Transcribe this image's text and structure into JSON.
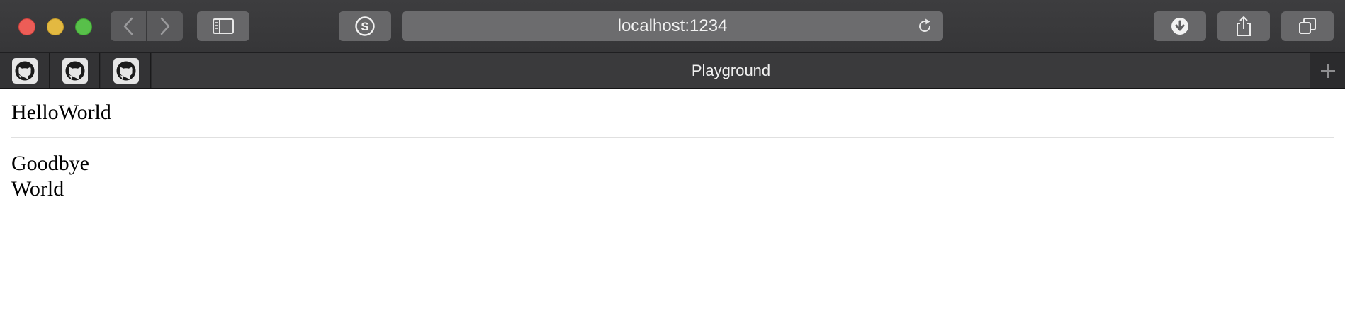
{
  "browser": {
    "address_bar": {
      "url": "localhost:1234"
    },
    "tabs": {
      "pinned": [
        {
          "icon": "github-icon"
        },
        {
          "icon": "github-icon"
        },
        {
          "icon": "github-icon"
        }
      ],
      "active_title": "Playground"
    },
    "colors": {
      "close": "#ed5d57",
      "minimize": "#e3b941",
      "zoom": "#58c04a"
    }
  },
  "page": {
    "line1_part1": "Hello",
    "line1_part2": "World",
    "line2": "Goodbye",
    "line3": "World"
  }
}
